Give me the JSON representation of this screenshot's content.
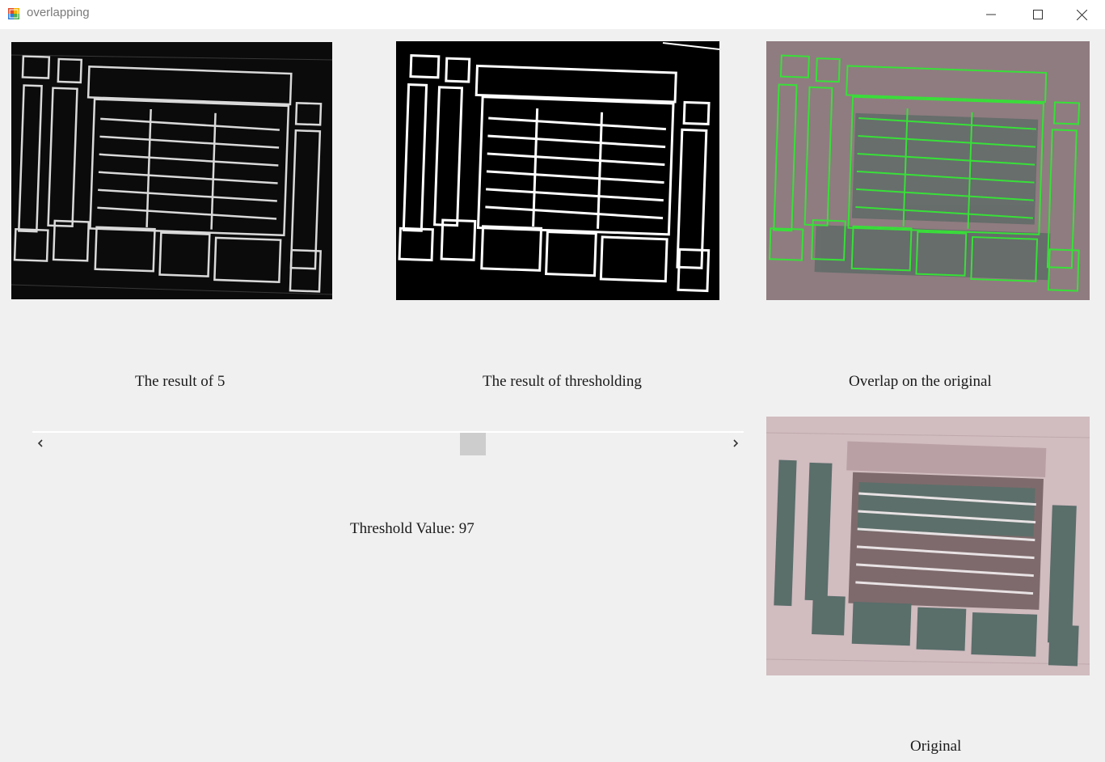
{
  "window": {
    "title": "overlapping",
    "icon": "winforms-app-icon",
    "controls": [
      "minimize-icon",
      "maximize-icon",
      "close-icon"
    ]
  },
  "panels": {
    "edge": {
      "caption": "The result of 5"
    },
    "threshold": {
      "caption": "The result of thresholding"
    },
    "overlap": {
      "caption": "Overlap on the original"
    },
    "original": {
      "caption": "Original"
    }
  },
  "threshold_control": {
    "label": "Threshold Value:",
    "value": "97",
    "slider_fraction": 0.63
  },
  "colors": {
    "background": "#f0f0f0",
    "overlay_edge": "#38e038",
    "facade": "#c9b4b8"
  }
}
